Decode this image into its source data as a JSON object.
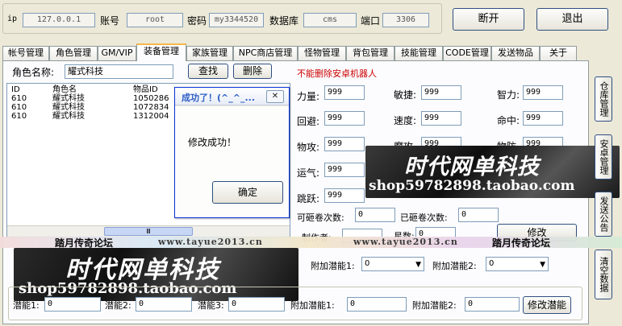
{
  "connection": {
    "ip_label": "ip",
    "ip_value": "127.0.0.1",
    "account_label": "账号",
    "account_value": "root",
    "password_label": "密码",
    "password_value": "my3344520",
    "database_label": "数据库",
    "database_value": "cms",
    "port_label": "端口",
    "port_value": "3306",
    "disconnect_label": "断开",
    "exit_label": "退出"
  },
  "tabs": [
    {
      "label": "帐号管理"
    },
    {
      "label": "角色管理"
    },
    {
      "label": "GM/VIP"
    },
    {
      "label": "装备管理"
    },
    {
      "label": "家族管理"
    },
    {
      "label": "NPC商店管理"
    },
    {
      "label": "怪物管理"
    },
    {
      "label": "背包管理"
    },
    {
      "label": "技能管理"
    },
    {
      "label": "CODE管理"
    },
    {
      "label": "发送物品"
    },
    {
      "label": "关于"
    }
  ],
  "equip": {
    "role_name_label": "角色名称:",
    "role_name_value": "耀式科技",
    "search_label": "查找",
    "delete_label": "删除",
    "warning": "不能删除安卓机器人",
    "columns": [
      "ID",
      "角色名",
      "物品ID"
    ],
    "rows": [
      [
        "610",
        "耀式科技",
        "1050286"
      ],
      [
        "610",
        "耀式科技",
        "1072834"
      ],
      [
        "610",
        "耀式科技",
        "1312004"
      ]
    ],
    "hscroll_thumb": "Ⅲ"
  },
  "stats": {
    "str_label": "力量:",
    "str_value": "999",
    "dex_label": "敏捷:",
    "dex_value": "999",
    "int_label": "智力:",
    "int_value": "999",
    "avoid_label": "回避:",
    "avoid_value": "999",
    "speed_label": "速度:",
    "speed_value": "999",
    "acc_label": "命中:",
    "acc_value": "999",
    "patk_label": "物攻:",
    "patk_value": "999",
    "matk_label": "魔攻",
    "matk_value": "999",
    "pdef_label": "物防",
    "pdef_value": "999",
    "luck_label": "运气:",
    "luck_value": "999",
    "mdef_label": "魔防",
    "mdef_value": "999",
    "jump_label": "跳跃:",
    "jump_value": "999",
    "scroll_avail_label": "可砸卷次数:",
    "scroll_avail_value": "0",
    "scroll_used_label": "已砸卷次数:",
    "scroll_used_value": "0",
    "maker_label": "制作者:",
    "stars_label": "星数:",
    "stars_value": "0",
    "modify_label": "修改",
    "extra_pot1_label": "附加潜能1:",
    "extra_pot1_value": "0",
    "extra_pot2_label": "附加潜能2:",
    "extra_pot2_value": "0"
  },
  "potential": {
    "pot1_label": "潜能1:",
    "pot1_value": "0",
    "pot2_label": "潜能2:",
    "pot2_value": "0",
    "pot3_label": "潜能3:",
    "pot3_value": "0",
    "extra1_label": "附加潜能1:",
    "extra1_value": "0",
    "extra2_label": "附加潜能2:",
    "extra2_value": "0",
    "modify_pot_label": "修改潜能"
  },
  "side_buttons": [
    {
      "label": "仓库管理"
    },
    {
      "label": "安卓管理"
    },
    {
      "label": "发送公告"
    },
    {
      "label": "清空数据"
    }
  ],
  "dialog": {
    "title": "成功了！(^_^_...",
    "close": "✕",
    "message": "修改成功！",
    "ok_label": "确定"
  },
  "watermark": {
    "brand": "时代网单科技",
    "shop": "shop59782898.taobao.com",
    "forum": "踏月传奇论坛",
    "url": "www.tayue2013.cn"
  },
  "colors": {
    "warning": "#cc0000",
    "dialog_title": "#2d5fc6",
    "tab_accent": "#f7b64a"
  }
}
